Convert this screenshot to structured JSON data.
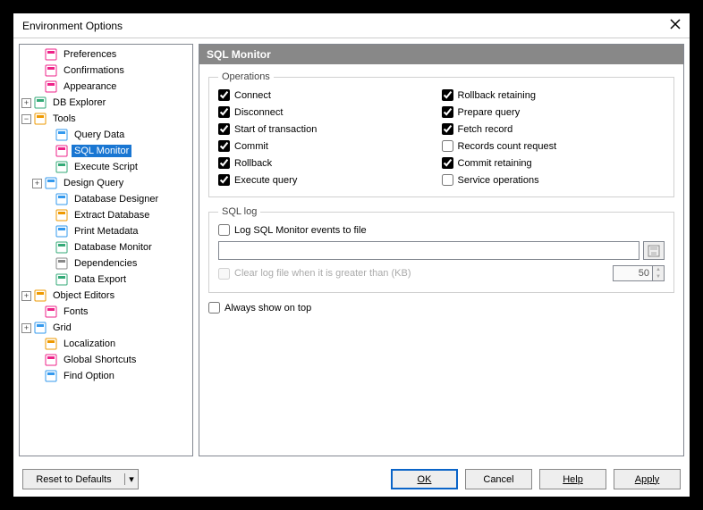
{
  "title": "Environment Options",
  "tree": [
    {
      "indent": 14,
      "exp": "none",
      "icon": "pref",
      "label": "Preferences"
    },
    {
      "indent": 14,
      "exp": "none",
      "icon": "conf",
      "label": "Confirmations"
    },
    {
      "indent": 14,
      "exp": "none",
      "icon": "app",
      "label": "Appearance"
    },
    {
      "indent": 2,
      "exp": "plus",
      "icon": "db",
      "label": "DB Explorer"
    },
    {
      "indent": 2,
      "exp": "minus",
      "icon": "tools",
      "label": "Tools"
    },
    {
      "indent": 26,
      "exp": "none",
      "icon": "qd",
      "label": "Query Data"
    },
    {
      "indent": 26,
      "exp": "none",
      "icon": "sql",
      "label": "SQL Monitor",
      "selected": true
    },
    {
      "indent": 26,
      "exp": "none",
      "icon": "exec",
      "label": "Execute Script"
    },
    {
      "indent": 14,
      "exp": "plus",
      "icon": "dq",
      "label": "Design Query"
    },
    {
      "indent": 26,
      "exp": "none",
      "icon": "dd",
      "label": "Database Designer"
    },
    {
      "indent": 26,
      "exp": "none",
      "icon": "ed",
      "label": "Extract Database"
    },
    {
      "indent": 26,
      "exp": "none",
      "icon": "pm",
      "label": "Print Metadata"
    },
    {
      "indent": 26,
      "exp": "none",
      "icon": "dm",
      "label": "Database Monitor"
    },
    {
      "indent": 26,
      "exp": "none",
      "icon": "dep",
      "label": "Dependencies"
    },
    {
      "indent": 26,
      "exp": "none",
      "icon": "de",
      "label": "Data Export"
    },
    {
      "indent": 2,
      "exp": "plus",
      "icon": "oe",
      "label": "Object Editors"
    },
    {
      "indent": 14,
      "exp": "none",
      "icon": "font",
      "label": "Fonts"
    },
    {
      "indent": 2,
      "exp": "plus",
      "icon": "grid",
      "label": "Grid"
    },
    {
      "indent": 14,
      "exp": "none",
      "icon": "loc",
      "label": "Localization"
    },
    {
      "indent": 14,
      "exp": "none",
      "icon": "gs",
      "label": "Global Shortcuts"
    },
    {
      "indent": 14,
      "exp": "none",
      "icon": "fo",
      "label": "Find Option"
    }
  ],
  "content_title": "SQL Monitor",
  "groups": {
    "operations": "Operations",
    "sqllog": "SQL log"
  },
  "ops_left": [
    {
      "label": "Connect",
      "checked": true
    },
    {
      "label": "Disconnect",
      "checked": true
    },
    {
      "label": "Start of transaction",
      "checked": true
    },
    {
      "label": "Commit",
      "checked": true
    },
    {
      "label": "Rollback",
      "checked": true
    },
    {
      "label": "Execute query",
      "checked": true
    }
  ],
  "ops_right": [
    {
      "label": "Rollback retaining",
      "checked": true
    },
    {
      "label": "Prepare query",
      "checked": true
    },
    {
      "label": "Fetch record",
      "checked": true
    },
    {
      "label": "Records count request",
      "checked": false
    },
    {
      "label": "Commit retaining",
      "checked": true
    },
    {
      "label": "Service operations",
      "checked": false
    }
  ],
  "sqllog": {
    "log_to_file": "Log SQL Monitor events to file",
    "log_path": "",
    "clear_label": "Clear log file when it is greater than (KB)",
    "clear_value": "50"
  },
  "always_on_top": "Always show on top",
  "buttons": {
    "reset": "Reset to Defaults",
    "ok": "OK",
    "cancel": "Cancel",
    "help": "Help",
    "apply": "Apply"
  }
}
